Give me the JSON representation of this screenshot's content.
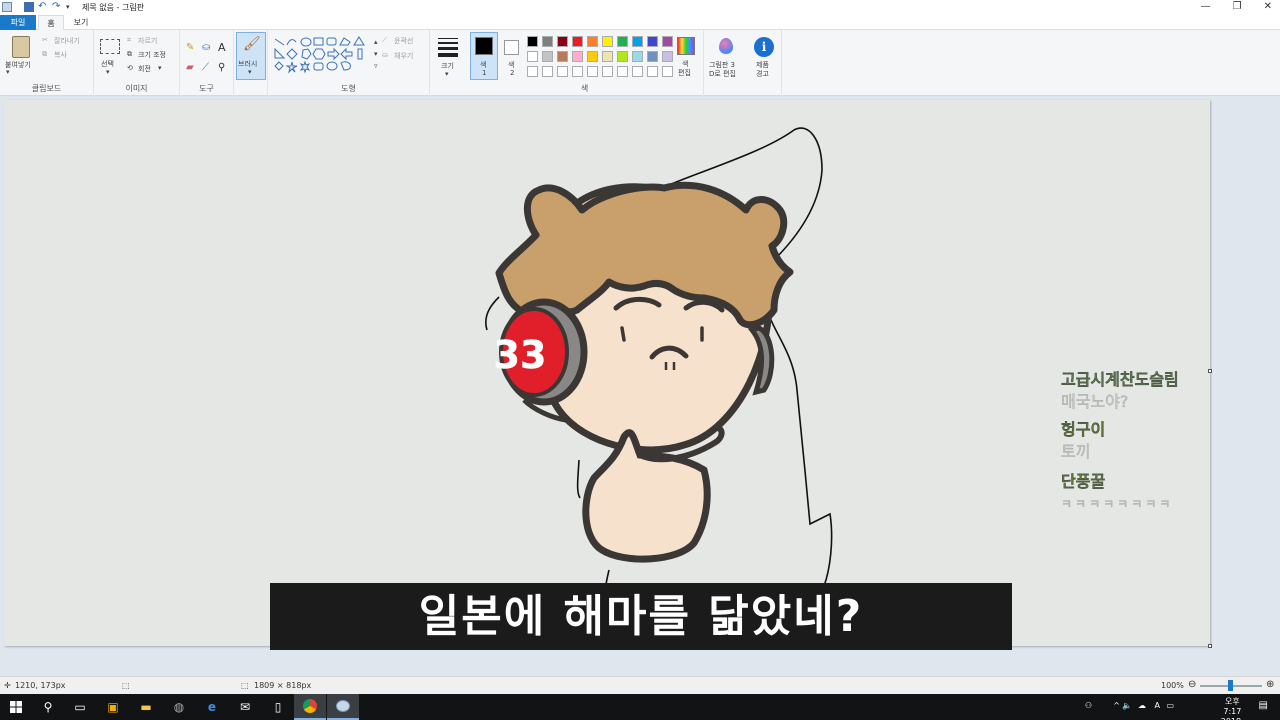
{
  "window": {
    "title": "제목 없음 - 그림판"
  },
  "tabs": {
    "file": "파일",
    "home": "홈",
    "view": "보기"
  },
  "ribbon": {
    "clipboard": {
      "paste": "붙여넣기",
      "cut": "잘라내기",
      "copy": "복사",
      "label": "클립보드"
    },
    "image": {
      "select": "선택",
      "crop": "자르기",
      "resize": "크기 조정",
      "rotate": "회전",
      "label": "이미지"
    },
    "tools": {
      "label": "도구"
    },
    "brushes": {
      "label": "브러시"
    },
    "shapes": {
      "outline": "윤곽선",
      "fill": "채우기",
      "label": "도형"
    },
    "size": {
      "label": "크기"
    },
    "colors": {
      "color1_line1": "색",
      "color1_line2": "1",
      "color2_line1": "색",
      "color2_line2": "2",
      "edit_line1": "색",
      "edit_line2": "편집",
      "label": "색",
      "palette_row1": [
        "#000000",
        "#7f7f7f",
        "#880015",
        "#ed1c24",
        "#ff7f27",
        "#fff200",
        "#22b14c",
        "#00a2e8",
        "#3f48cc",
        "#a349a4"
      ],
      "palette_row2": [
        "#ffffff",
        "#c3c3c3",
        "#b97a57",
        "#ffaec9",
        "#ffc90e",
        "#efe4b0",
        "#b5e61d",
        "#99d9ea",
        "#7092be",
        "#c8bfe7"
      ],
      "palette_row3": [
        "#ffffff",
        "#ffffff",
        "#ffffff",
        "#ffffff",
        "#ffffff",
        "#ffffff",
        "#ffffff",
        "#ffffff",
        "#ffffff",
        "#ffffff"
      ]
    },
    "paint3d": {
      "line1": "그림판 3",
      "line2": "D로 편집"
    },
    "product_alert": {
      "line1": "제품",
      "line2": "경고"
    }
  },
  "canvas": {
    "badge_number": "33"
  },
  "chat": [
    {
      "nick": "고급시계찬도슬림",
      "msg": "매국노야?"
    },
    {
      "nick": "헝구이",
      "msg": "토끼"
    },
    {
      "nick": "단풍꿀",
      "msg": "ㅋㅋㅋㅋㅋㅋㅋㅋ"
    }
  ],
  "subtitle": "일본에 해마를 닮았네?",
  "status": {
    "cursor_pos": "1210, 173px",
    "canvas_size": "1809 × 818px",
    "zoom": "100%"
  },
  "taskbar": {
    "time": "오후 7:17",
    "date": "2018-12-09",
    "ime": "A"
  }
}
